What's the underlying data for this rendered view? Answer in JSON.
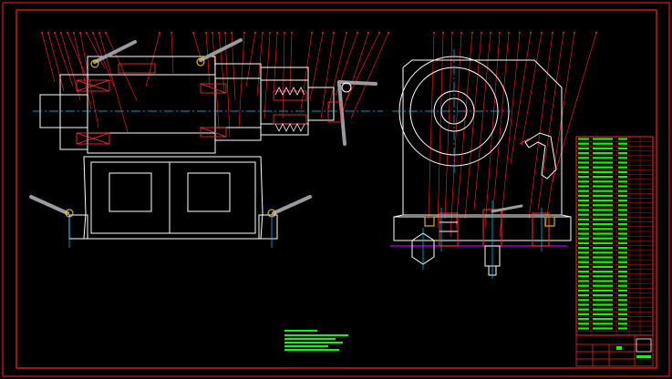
{
  "colors": {
    "background": "#000000",
    "frame": "#ff2020",
    "outline": "#ffffff",
    "centerline": "#00c8ff",
    "hatch": "#ff3030",
    "leader": "#ff2020",
    "notes": "#00ff00",
    "title_block": "#ff2020",
    "section_line": "#b000ff",
    "handle": "#9a9aa0",
    "fixture_part": "#ffd800",
    "cyan_part": "#00e0e0"
  },
  "drawing": {
    "views": [
      "front-section-view",
      "side-view",
      "parts-list",
      "technical-notes",
      "title-block"
    ],
    "icons": [
      "handle-lever-icon",
      "handwheel-icon",
      "rotary-disk-icon",
      "clamp-icon"
    ]
  }
}
